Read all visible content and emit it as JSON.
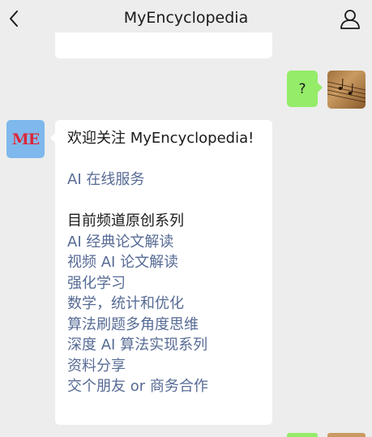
{
  "header": {
    "title": "MyEncyclopedia"
  },
  "messages": {
    "user_message": "?",
    "bot_avatar_text": "ME",
    "bot_welcome": "欢迎关注 MyEncyclopedia!",
    "service_link": "AI 在线服务",
    "series_heading": "目前频道原创系列",
    "series_links": [
      "AI 经典论文解读",
      "视频 AI 论文解读",
      "强化学习",
      "数学，统计和优化",
      "算法刷题多角度思维",
      "深度 AI 算法实现系列",
      "资料分享",
      "交个朋友 or 商务合作"
    ]
  },
  "colors": {
    "background": "#ededed",
    "bubble_user": "#95ec69",
    "bubble_bot": "#ffffff",
    "link": "#576b95"
  },
  "icons": [
    "back-arrow-icon",
    "user-profile-icon"
  ]
}
